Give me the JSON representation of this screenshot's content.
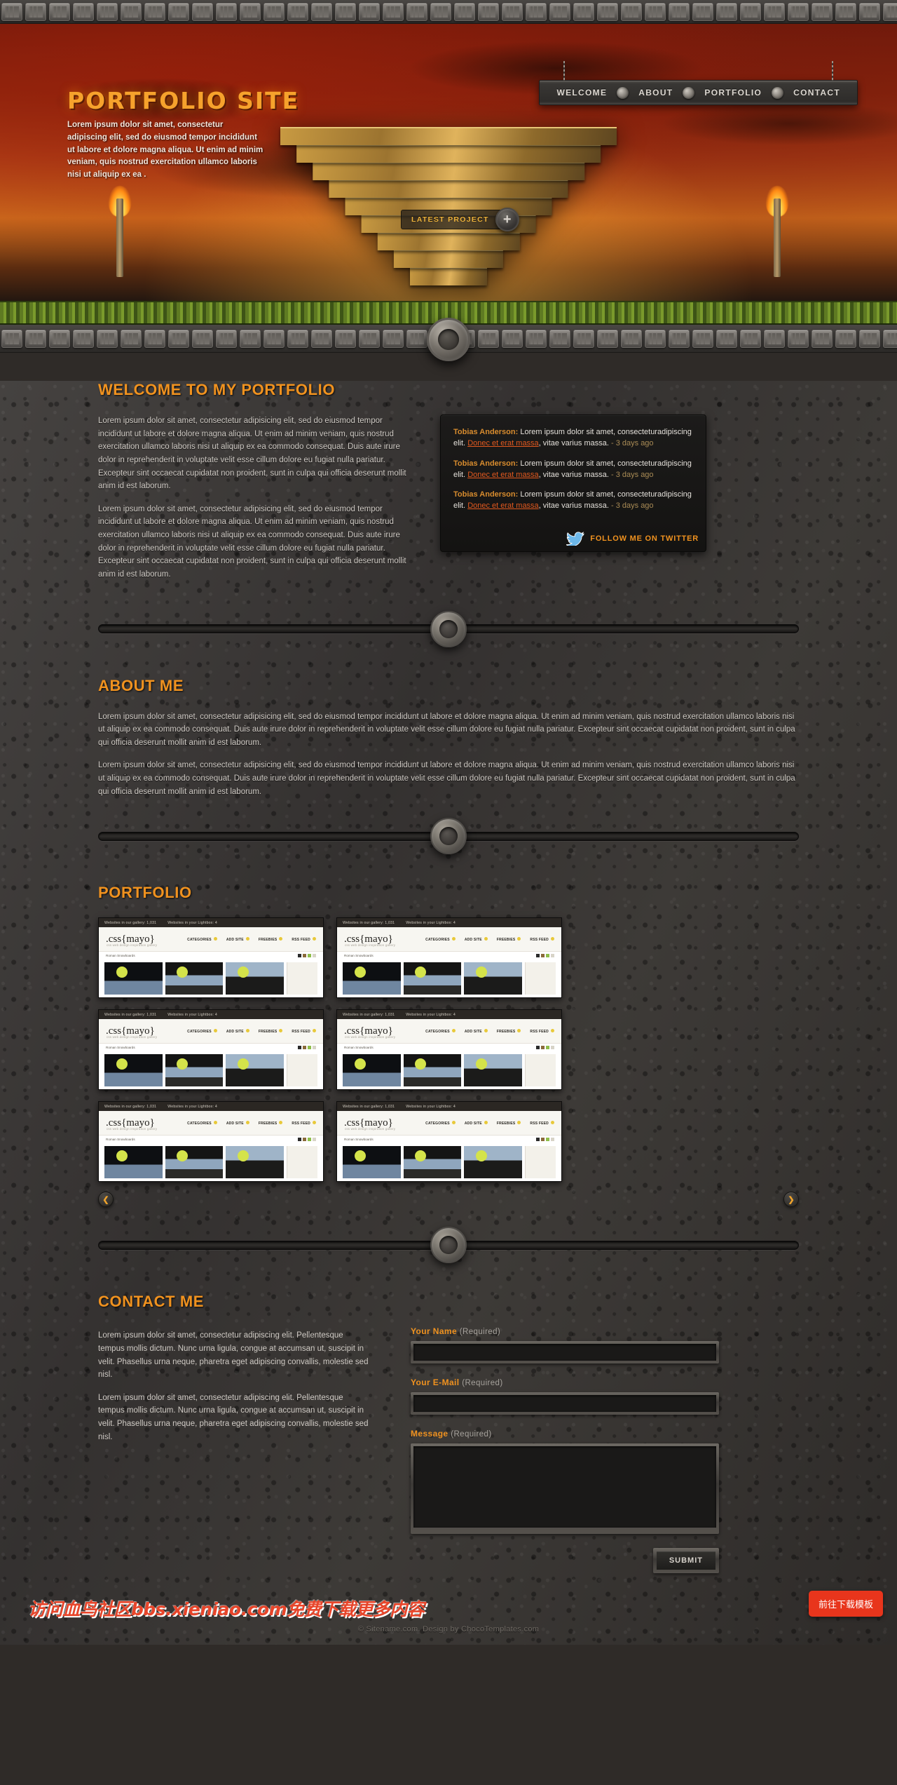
{
  "site": {
    "hero_title": "PORTFOLIO SITE",
    "hero_copy": "Lorem ipsum dolor sit amet, consectetur adipiscing elit, sed do eiusmod tempor incididunt ut labore et dolore magna aliqua. Ut enim ad minim veniam, quis nostrud exercitation ullamco laboris nisi ut aliquip ex ea .",
    "latest_project_label": "LATEST PROJECT",
    "latest_project_plus": "+"
  },
  "nav": {
    "items": [
      {
        "label": "WELCOME"
      },
      {
        "label": "ABOUT"
      },
      {
        "label": "PORTFOLIO"
      },
      {
        "label": "CONTACT"
      }
    ]
  },
  "welcome": {
    "heading": "WELCOME TO MY PORTFOLIO",
    "paragraphs": [
      "Lorem ipsum dolor sit amet, consectetur adipisicing elit, sed do eiusmod tempor incididunt ut labore et dolore magna aliqua. Ut enim ad minim veniam, quis nostrud exercitation ullamco laboris nisi ut aliquip ex ea commodo consequat. Duis aute irure dolor in reprehenderit in voluptate velit esse cillum dolore eu fugiat nulla pariatur. Excepteur sint occaecat cupidatat non proident, sunt in culpa qui officia deserunt mollit anim id est laborum.",
      "Lorem ipsum dolor sit amet, consectetur adipisicing elit, sed do eiusmod tempor incididunt ut labore et dolore magna aliqua. Ut enim ad minim veniam, quis nostrud exercitation ullamco laboris nisi ut aliquip ex ea commodo consequat. Duis aute irure dolor in reprehenderit in voluptate velit esse cillum dolore eu fugiat nulla pariatur. Excepteur sint occaecat cupidatat non proident, sunt in culpa qui officia deserunt mollit anim id est laborum."
    ]
  },
  "twitter": {
    "tweets": [
      {
        "user": "Tobias Anderson:",
        "text_before": " Lorem ipsum dolor sit amet, consecteturadipiscing elit. ",
        "link": "Donec et erat massa",
        "text_after": ", vitae varius massa.",
        "time": " - 3 days ago"
      },
      {
        "user": "Tobias Anderson:",
        "text_before": " Lorem ipsum dolor sit amet, consecteturadipiscing elit. ",
        "link": "Donec et erat massa",
        "text_after": ", vitae varius massa.",
        "time": " - 3 days ago"
      },
      {
        "user": "Tobias Anderson:",
        "text_before": " Lorem ipsum dolor sit amet, consecteturadipiscing elit. ",
        "link": "Donec et erat massa",
        "text_after": ", vitae varius massa.",
        "time": " - 3 days ago"
      }
    ],
    "follow_label": "FOLLOW ME ON TWITTER",
    "bird_icon": "twitter-bird-icon"
  },
  "about": {
    "heading": "ABOUT ME",
    "paragraphs": [
      "Lorem ipsum dolor sit amet, consectetur adipisicing elit, sed do eiusmod tempor incididunt ut labore et dolore magna aliqua. Ut enim ad minim veniam, quis nostrud exercitation ullamco laboris nisi ut aliquip ex ea commodo consequat. Duis aute irure dolor in reprehenderit in voluptate velit esse cillum dolore eu fugiat nulla pariatur. Excepteur sint occaecat cupidatat non proident, sunt in culpa qui officia deserunt mollit anim id est laborum.",
      "Lorem ipsum dolor sit amet, consectetur adipisicing elit, sed do eiusmod tempor incididunt ut labore et dolore magna aliqua. Ut enim ad minim veniam, quis nostrud exercitation ullamco laboris nisi ut aliquip ex ea commodo consequat. Duis aute irure dolor in reprehenderit in voluptate velit esse cillum dolore eu fugiat nulla pariatur. Excepteur sint occaecat cupidatat non proident, sunt in culpa qui officia deserunt mollit anim id est laborum."
    ]
  },
  "portfolio": {
    "heading": "PORTFOLIO",
    "prev_label": "❮",
    "next_label": "❯",
    "thumb": {
      "topbar_left": "Websites in our gallery:  1,031",
      "topbar_right": "Websites in your Lightbox: 4",
      "logo": ".css{mayo}",
      "tagline": "css web design inspiration gallery",
      "nav": [
        "CATEGORIES",
        "ADD SITE",
        "FREEBIES",
        "RSS FEED"
      ],
      "subbar": "Roman Snowboards"
    },
    "items": [
      {
        "id": "thumb-1"
      },
      {
        "id": "thumb-2"
      },
      {
        "id": "thumb-3"
      },
      {
        "id": "thumb-4"
      },
      {
        "id": "thumb-5"
      },
      {
        "id": "thumb-6"
      }
    ]
  },
  "contact": {
    "heading": "CONTACT ME",
    "paragraphs": [
      "Lorem ipsum dolor sit amet, consectetur adipiscing elit. Pellentesque tempus mollis dictum. Nunc urna ligula, congue at accumsan ut, suscipit in velit. Phasellus urna neque, pharetra eget adipiscing convallis, molestie sed nisl.",
      "Lorem ipsum dolor sit amet, consectetur adipiscing elit. Pellentesque tempus mollis dictum. Nunc urna ligula, congue at accumsan ut, suscipit in velit. Phasellus urna neque, pharetra eget adipiscing convallis, molestie sed nisl."
    ],
    "fields": [
      {
        "label": "Your Name",
        "required": "(Required)",
        "value": "",
        "placeholder": ""
      },
      {
        "label": "Your E-Mail",
        "required": "(Required)",
        "value": "",
        "placeholder": ""
      },
      {
        "label": "Message",
        "required": "(Required)",
        "value": "",
        "placeholder": ""
      }
    ],
    "submit_label": "SUBMIT"
  },
  "footer": {
    "watermark": "访问血鸟社区bbs.xieniao.com免费下载更多内容",
    "copyright": "© Sitename.com. Design by ChocoTemplates.com",
    "download_button": "前往下载模板"
  },
  "colors": {
    "accent_orange": "#f0921f",
    "link_orange": "#e2591f",
    "tweet_user": "#d88c2e",
    "download_red": "#e8351c"
  }
}
